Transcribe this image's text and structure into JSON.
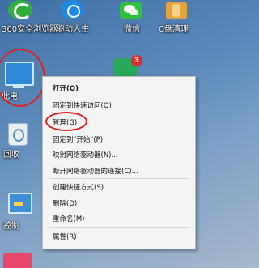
{
  "desktop": {
    "icons": [
      {
        "label": "360安全浏览器",
        "icon": "360-browser-icon"
      },
      {
        "label": "驱动人生",
        "icon": "driver-life-icon"
      },
      {
        "label": "微信",
        "icon": "wechat-icon"
      },
      {
        "label": "C盘清理",
        "icon": "c-drive-cleaner-icon"
      },
      {
        "label": "此电",
        "icon": "this-pc-icon"
      },
      {
        "label": "回收",
        "icon": "recycle-bin-icon"
      },
      {
        "label": "控制",
        "icon": "control-panel-icon"
      }
    ],
    "badge_count": "3"
  },
  "context_menu": {
    "items": [
      {
        "label": "打开(O)",
        "bold": true
      },
      {
        "label": "固定到快速访问(Q)"
      },
      {
        "label": "管理(G)"
      },
      {
        "label": "固定到\"开始\"(P)"
      },
      {
        "label": "映射网络驱动器(N)..."
      },
      {
        "label": "断开网络驱动器的连接(C)..."
      },
      {
        "label": "创建快捷方式(S)"
      },
      {
        "label": "删除(D)"
      },
      {
        "label": "重命名(M)"
      },
      {
        "label": "属性(R)"
      }
    ]
  },
  "colors": {
    "annotation": "#e0201c",
    "menu_bg": "#f4f4f4",
    "desktop_bg": "#4a7bb0"
  }
}
